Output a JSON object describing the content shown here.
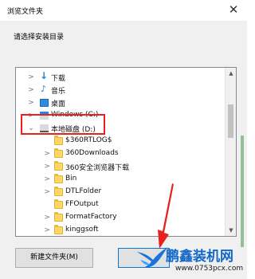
{
  "dialog": {
    "title": "浏览文件夹",
    "close_glyph": "✕",
    "prompt": "请选择安装目录"
  },
  "tree": {
    "items": [
      {
        "label": "下载",
        "icon": "download-icon",
        "arrow": ">"
      },
      {
        "label": "音乐",
        "icon": "music-icon",
        "arrow": ">"
      },
      {
        "label": "桌面",
        "icon": "desktop-icon",
        "arrow": ">"
      },
      {
        "label": "Windows (C:)",
        "icon": "drive-icon",
        "arrow": ">"
      },
      {
        "label": "本地磁盘 (D:)",
        "icon": "drive-icon",
        "arrow": "⌄"
      },
      {
        "label": "$360RTLOG$",
        "icon": "folder-icon",
        "arrow": ""
      },
      {
        "label": "360Downloads",
        "icon": "folder-icon",
        "arrow": ">"
      },
      {
        "label": "360安全浏览器下载",
        "icon": "folder-icon",
        "arrow": ">"
      },
      {
        "label": "Bin",
        "icon": "folder-icon",
        "arrow": ">"
      },
      {
        "label": "DTLFolder",
        "icon": "folder-icon",
        "arrow": ">"
      },
      {
        "label": "FFOutput",
        "icon": "folder-icon",
        "arrow": ""
      },
      {
        "label": "FormatFactory",
        "icon": "folder-icon",
        "arrow": ">"
      },
      {
        "label": "kinggsoft",
        "icon": "folder-icon",
        "arrow": ">"
      }
    ],
    "scroll_up_glyph": "▲",
    "scroll_down_glyph": "▼"
  },
  "buttons": {
    "new_folder": "新建文件夹(M)",
    "ok": ""
  },
  "watermark": {
    "brand": "鹏鑫装机网",
    "url": "www.0753pcx.com"
  },
  "colors": {
    "highlight": "#e8201e",
    "accent": "#0078d7",
    "folder": "#ffd766"
  }
}
